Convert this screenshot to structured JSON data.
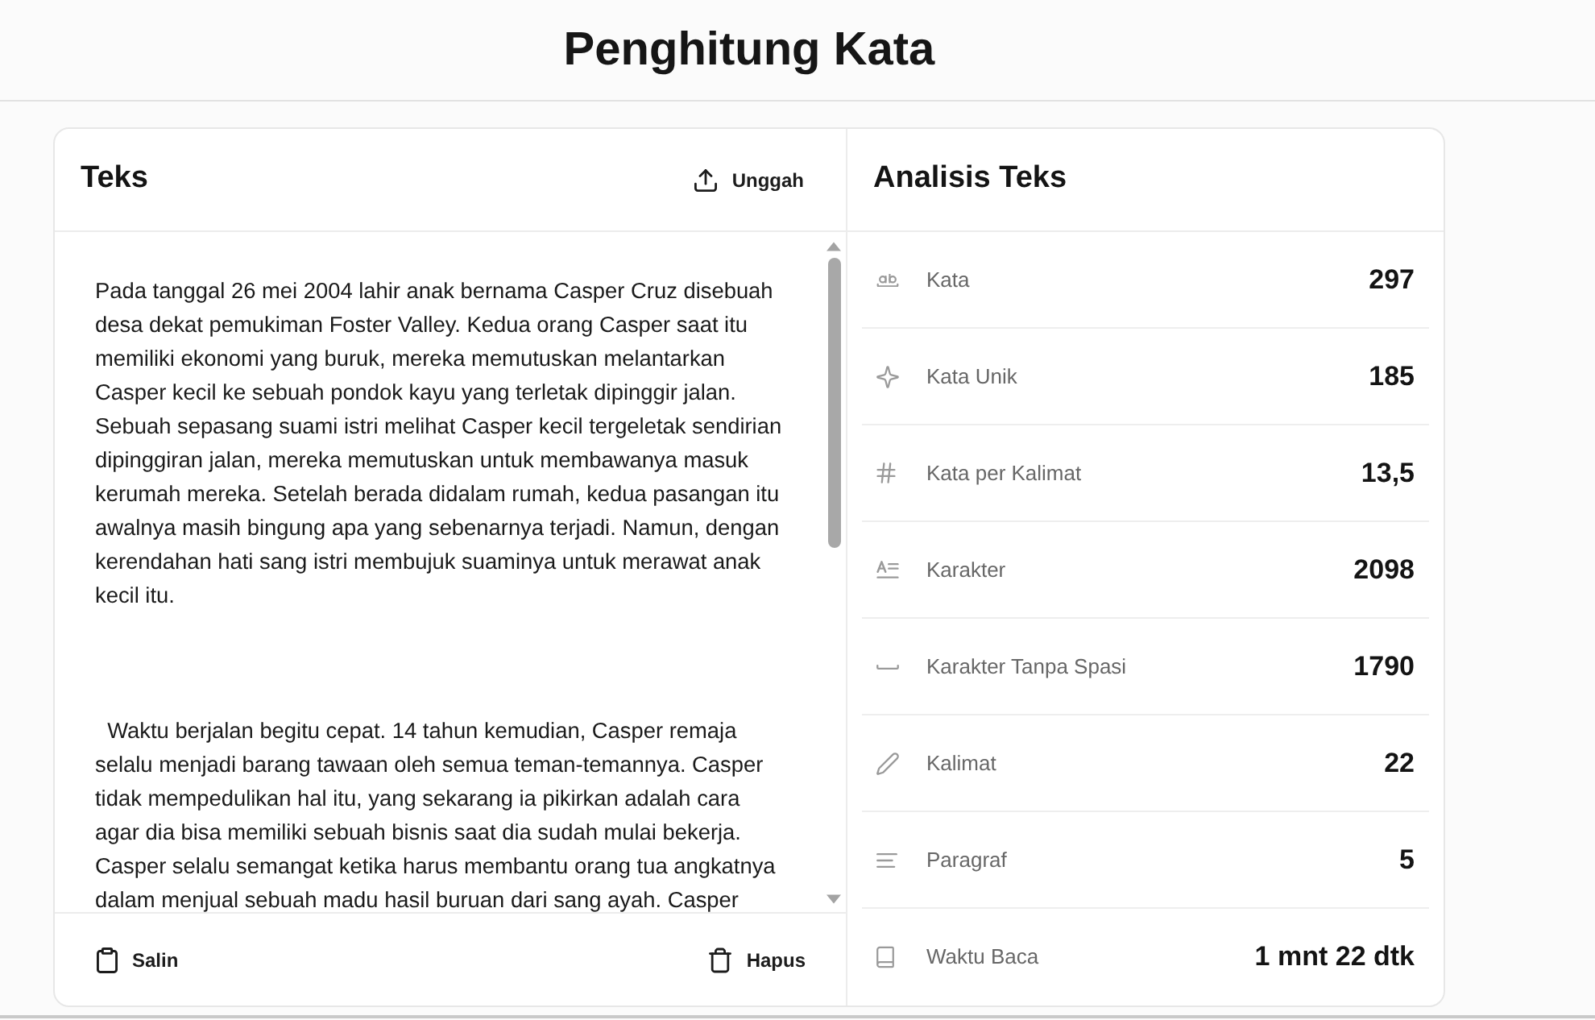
{
  "app": {
    "title": "Penghitung Kata"
  },
  "editor": {
    "title": "Teks",
    "upload_button": "Unggah",
    "text": "Pada tanggal 26 mei 2004 lahir anak bernama Casper Cruz disebuah desa dekat pemukiman Foster Valley. Kedua orang Casper saat itu memiliki ekonomi yang buruk, mereka memutuskan melantarkan Casper kecil ke sebuah pondok kayu yang terletak dipinggir jalan. Sebuah sepasang suami istri melihat Casper kecil tergeletak sendirian dipinggiran jalan, mereka memutuskan untuk membawanya masuk kerumah mereka. Setelah berada didalam rumah, kedua pasangan itu awalnya masih bingung apa yang sebenarnya terjadi. Namun, dengan kerendahan hati sang istri membujuk suaminya untuk merawat anak kecil itu.\n\n\n\n  Waktu berjalan begitu cepat. 14 tahun kemudian, Casper remaja selalu menjadi barang tawaan oleh semua teman-temannya. Casper tidak mempedulikan hal itu, yang sekarang ia pikirkan adalah cara agar dia bisa memiliki sebuah bisnis saat dia sudah mulai bekerja. Casper selalu semangat ketika harus membantu orang tua angkatnya dalam menjual sebuah madu hasil buruan dari sang ayah. Casper",
    "copy_button": "Salin",
    "clear_button": "Hapus"
  },
  "analysis": {
    "title": "Analisis Teks",
    "stats": [
      {
        "kind": "words",
        "label": "Kata",
        "value": "297"
      },
      {
        "kind": "unique_words",
        "label": "Kata Unik",
        "value": "185"
      },
      {
        "kind": "words_per_sentence",
        "label": "Kata per Kalimat",
        "value": "13,5"
      },
      {
        "kind": "characters",
        "label": "Karakter",
        "value": "2098"
      },
      {
        "kind": "characters_no_spaces",
        "label": "Karakter Tanpa Spasi",
        "value": "1790"
      },
      {
        "kind": "sentences",
        "label": "Kalimat",
        "value": "22"
      },
      {
        "kind": "paragraphs",
        "label": "Paragraf",
        "value": "5"
      },
      {
        "kind": "reading_time",
        "label": "Waktu Baca",
        "value": "1 mnt 22 dtk"
      }
    ]
  }
}
